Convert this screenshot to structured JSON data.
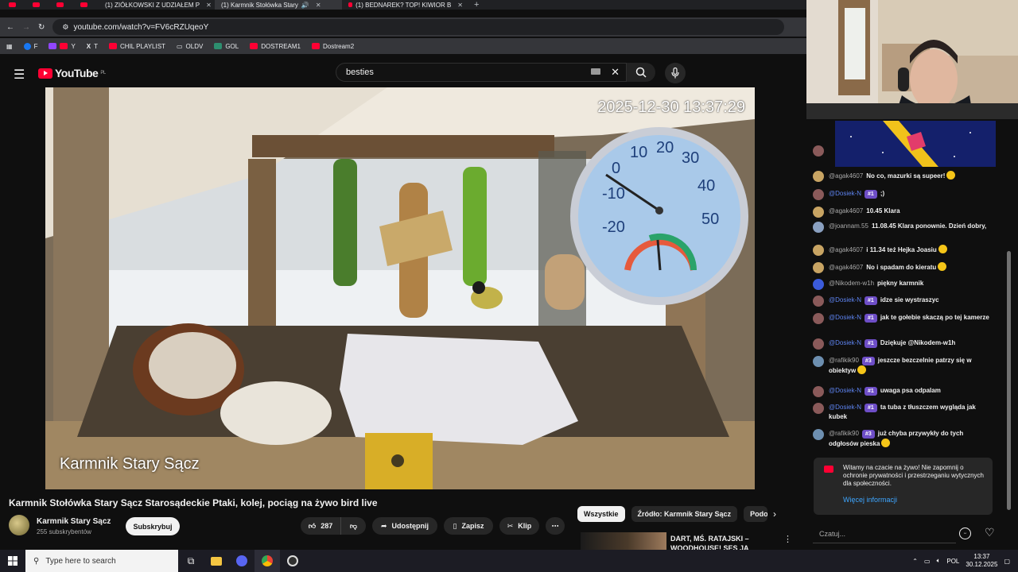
{
  "browser": {
    "tabs": [
      {
        "label": "(1) ZIÓŁKOWSKI Z UDZIAŁEM P",
        "active": false
      },
      {
        "label": "(1) Karmnik Stołówka Stary",
        "active": true
      },
      {
        "label": "(1) BEDNAREK? TOP! KIWIOR B",
        "active": false
      }
    ],
    "new_tab": "+",
    "url": "youtube.com/watch?v=FV6cRZUqeoY",
    "bookmarks": [
      "F",
      "Y",
      "T",
      "CHIL PLAYLIST",
      "OLDV",
      "GOL",
      "DOSTREAM1",
      "Dostream2"
    ]
  },
  "youtube": {
    "logo": "YouTube",
    "logo_region": "PL",
    "search_query": "besties"
  },
  "video": {
    "timestamp": "2025-12-30 13:37:29",
    "camera_label": "Karmnik Stary Sącz",
    "title": "Karmnik Stołówka Stary Sącz Starosądeckie Ptaki, kolej, pociąg na żywo bird live",
    "channel_name": "Karmnik Stary Sącz",
    "subscribers": "255 subskrybentów",
    "subscribe_label": "Subskrybuj",
    "likes": "287",
    "share_label": "Udostępnij",
    "save_label": "Zapisz",
    "clip_label": "Klip",
    "more_label": "⋯"
  },
  "recommendations": {
    "chips": [
      "Wszystkie",
      "Źródło: Karmnik Stary Sącz",
      "Podob"
    ],
    "first_title": "DART, MŚ. RATAJSKI – WOODHOUSE! SES JA"
  },
  "chat": {
    "messages": [
      {
        "author": "@agak4607",
        "mod": false,
        "badge": "",
        "text": "No co, mazurki są supeer!",
        "emoji": true,
        "avatar": "#c8a463"
      },
      {
        "author": "@Dosiek-N",
        "mod": true,
        "badge": "#1",
        "text": ";)",
        "emoji": false,
        "avatar": "#8a5a5a"
      },
      {
        "author": "@agak4607",
        "mod": false,
        "badge": "",
        "text": "10.45 Klara",
        "emoji": false,
        "avatar": "#c8a463"
      },
      {
        "author": "@joannam.55",
        "mod": false,
        "badge": "",
        "text": "11.08.45 Klara ponownie. Dzień dobry,",
        "emoji": false,
        "avatar": "#8aa0c0"
      },
      {
        "author": "@agak4607",
        "mod": false,
        "badge": "",
        "text": "i 11.34 też Hejka Joasiu",
        "emoji": true,
        "avatar": "#c8a463"
      },
      {
        "author": "@agak4607",
        "mod": false,
        "badge": "",
        "text": "No i spadam do kieratu",
        "emoji": true,
        "avatar": "#c8a463"
      },
      {
        "author": "@Nikodem-w1h",
        "mod": false,
        "badge": "",
        "text": "piękny karmnik",
        "emoji": false,
        "avatar": "#3b5bdb"
      },
      {
        "author": "@Dosiek-N",
        "mod": true,
        "badge": "#1",
        "text": "idze sie wystraszyc",
        "emoji": false,
        "avatar": "#8a5a5a"
      },
      {
        "author": "@Dosiek-N",
        "mod": true,
        "badge": "#1",
        "text": "jak te gołebie skaczą po tej kamerze",
        "emoji": false,
        "avatar": "#8a5a5a"
      },
      {
        "author": "@Dosiek-N",
        "mod": true,
        "badge": "#1",
        "text": "Dziękuje @Nikodem-w1h",
        "emoji": false,
        "avatar": "#8a5a5a"
      },
      {
        "author": "@rafikik90",
        "mod": false,
        "badge": "#3",
        "text": "jeszcze bezczelnie patrzy się w obiektyw",
        "emoji": true,
        "avatar": "#6d8fb0"
      },
      {
        "author": "@Dosiek-N",
        "mod": true,
        "badge": "#1",
        "text": "uwaga psa odpalam",
        "emoji": false,
        "avatar": "#8a5a5a"
      },
      {
        "author": "@Dosiek-N",
        "mod": true,
        "badge": "#1",
        "text": "ta tuba z tłuszczem wygląda jak kubek",
        "emoji": false,
        "avatar": "#8a5a5a"
      },
      {
        "author": "@rafikik90",
        "mod": false,
        "badge": "#3",
        "text": "już chyba przywykły do tych odgłosów pieska",
        "emoji": true,
        "avatar": "#6d8fb0"
      }
    ],
    "notice": "Witamy na czacie na żywo! Nie zapomnij o ochronie prywatności i przestrzeganiu wytycznych dla społeczności.",
    "notice_link": "Więcej informacji",
    "input_placeholder": "Czatuj..."
  },
  "taskbar": {
    "search_placeholder": "Type here to search",
    "language": "POL",
    "time": "13:37",
    "date": "30.12.2025"
  }
}
